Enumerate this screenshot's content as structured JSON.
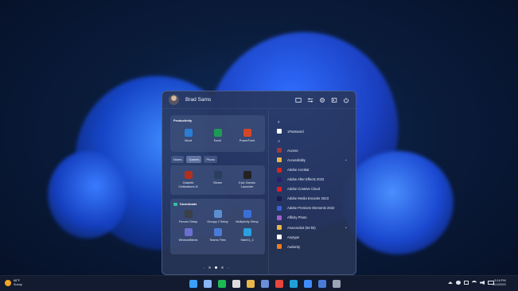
{
  "user": {
    "name": "Brad Sams"
  },
  "header_icons": [
    "folder-icon",
    "sliders-icon",
    "settings-icon",
    "lock-icon",
    "power-icon"
  ],
  "productivity": {
    "title": "Productivity",
    "apps": [
      {
        "label": "Word",
        "icon": "word-icon",
        "color": "#2b7cd3"
      },
      {
        "label": "Excel",
        "icon": "excel-icon",
        "color": "#1d9a54"
      },
      {
        "label": "PowerPoint",
        "icon": "powerpoint-icon",
        "color": "#d24726"
      }
    ]
  },
  "tabs": [
    {
      "label": "Notes"
    },
    {
      "label": "Games"
    },
    {
      "label": "Photo"
    }
  ],
  "games": {
    "apps": [
      {
        "label": "Galactic Civilizations III",
        "icon": "galciv-icon",
        "color": "#b03020"
      },
      {
        "label": "Steam",
        "icon": "steam-icon",
        "color": "#2a3f5f"
      },
      {
        "label": "Epic Games Launcher",
        "icon": "epic-games-icon",
        "color": "#222222"
      }
    ]
  },
  "downloads": {
    "title": "Downloads",
    "apps": [
      {
        "label": "Fences Setup",
        "icon": "fences-icon",
        "color": "#3a3f48"
      },
      {
        "label": "Groupy 2 Setup",
        "icon": "groupy-icon",
        "color": "#5a8fd0"
      },
      {
        "label": "Multiplicity Setup",
        "icon": "multiplicity-icon",
        "color": "#3b6fd8"
      },
      {
        "label": "WindowBlinds",
        "icon": "windowblinds-icon",
        "color": "#6a6fd0"
      },
      {
        "label": "Teams Files",
        "icon": "teams-files-icon",
        "color": "#4a7bd8"
      },
      {
        "label": "Start11_2",
        "icon": "start11-icon",
        "color": "#2aa0e0"
      }
    ]
  },
  "app_list": [
    {
      "kind": "letter",
      "label": "#"
    },
    {
      "kind": "app",
      "label": "1Password",
      "icon": "onepassword-icon",
      "color": "#ffffff"
    },
    {
      "kind": "letter",
      "label": "A"
    },
    {
      "kind": "app",
      "label": "Access",
      "icon": "access-icon",
      "color": "#a4373a"
    },
    {
      "kind": "app",
      "label": "Accessibility",
      "icon": "folder-icon",
      "color": "#e8b64a",
      "chevron": true
    },
    {
      "kind": "app",
      "label": "Adobe Acrobat",
      "icon": "acrobat-icon",
      "color": "#d4261e"
    },
    {
      "kind": "app",
      "label": "Adobe After Effects 2023",
      "icon": "after-effects-icon",
      "color": "#2a1f6e"
    },
    {
      "kind": "app",
      "label": "Adobe Creative Cloud",
      "icon": "creative-cloud-icon",
      "color": "#da1f26"
    },
    {
      "kind": "app",
      "label": "Adobe Media Encoder 2023",
      "icon": "media-encoder-icon",
      "color": "#1b1b4d"
    },
    {
      "kind": "app",
      "label": "Adobe Premiere Elements 2022",
      "icon": "premiere-elements-icon",
      "color": "#3a5fd8"
    },
    {
      "kind": "app",
      "label": "Affinity Photo",
      "icon": "affinity-photo-icon",
      "color": "#a35fd0"
    },
    {
      "kind": "app",
      "label": "Anaconda3 (64-bit)",
      "icon": "folder-icon",
      "color": "#e8b64a",
      "chevron": true
    },
    {
      "kind": "app",
      "label": "Anytype",
      "icon": "anytype-icon",
      "color": "#ffffff"
    },
    {
      "kind": "app",
      "label": "Audacity",
      "icon": "audacity-icon",
      "color": "#f07c1d"
    }
  ],
  "weather": {
    "temp": "66°F",
    "condition": "Sunny"
  },
  "taskbar_icons": [
    {
      "icon": "start-icon",
      "color": "#3aa0ff"
    },
    {
      "icon": "grid-icon",
      "color": "#8ab4f8"
    },
    {
      "icon": "spotify-icon",
      "color": "#1db954"
    },
    {
      "icon": "threads-icon",
      "color": "#dddddd"
    },
    {
      "icon": "explorer-icon",
      "color": "#e8b64a"
    },
    {
      "icon": "mail-icon",
      "color": "#6a8fd8"
    },
    {
      "icon": "chrome-icon",
      "color": "#e8453c"
    },
    {
      "icon": "edge-icon",
      "color": "#1fa0d8"
    },
    {
      "icon": "photos-icon",
      "color": "#3f8bff"
    },
    {
      "icon": "store-icon",
      "color": "#4a7bd8"
    },
    {
      "icon": "settings-icon",
      "color": "#9aa5b8"
    }
  ],
  "clock": {
    "time": "5:16 PM",
    "date": "11/1/2023"
  }
}
